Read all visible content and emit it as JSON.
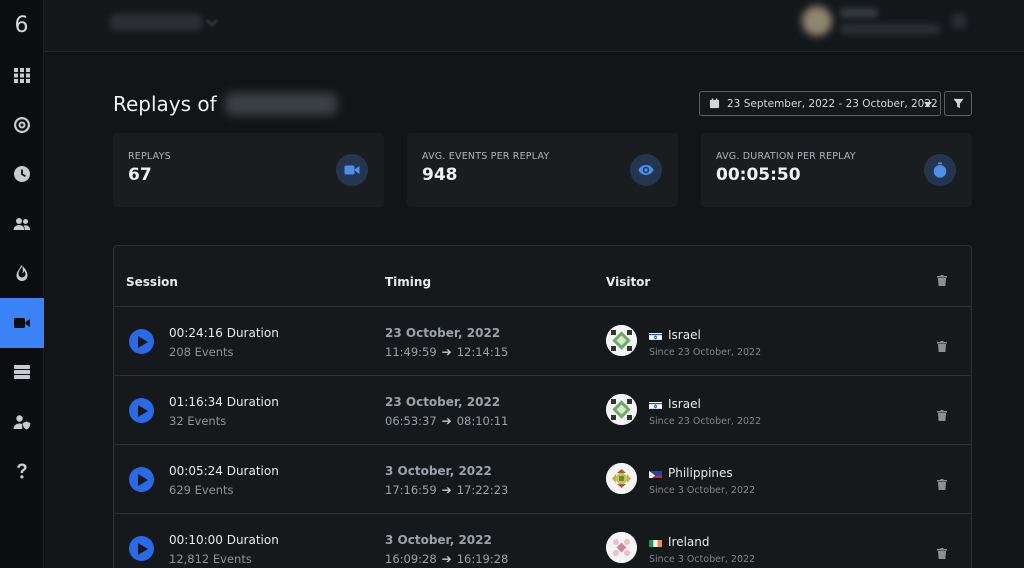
{
  "app": {
    "logo": "6"
  },
  "sidebar": {
    "items": [
      {
        "name": "dashboard",
        "icon": "grid-icon",
        "active": false
      },
      {
        "name": "goals",
        "icon": "target-icon",
        "active": false
      },
      {
        "name": "realtime",
        "icon": "clock-icon",
        "active": false
      },
      {
        "name": "visitors",
        "icon": "users-icon",
        "active": false
      },
      {
        "name": "heatmaps",
        "icon": "fire-icon",
        "active": false
      },
      {
        "name": "replays",
        "icon": "video-icon",
        "active": true
      },
      {
        "name": "data",
        "icon": "server-icon",
        "active": false
      },
      {
        "name": "users",
        "icon": "user-shield-icon",
        "active": false
      },
      {
        "name": "help",
        "icon": "question-icon",
        "active": false
      }
    ]
  },
  "page": {
    "title": "Replays of",
    "date_range": "23 September, 2022 - 23 October, 2022"
  },
  "stats": [
    {
      "label": "REPLAYS",
      "value": "67",
      "icon": "video-icon"
    },
    {
      "label": "AVG. EVENTS PER REPLAY",
      "value": "948",
      "icon": "eye-icon"
    },
    {
      "label": "AVG. DURATION PER REPLAY",
      "value": "00:05:50",
      "icon": "stopwatch-icon"
    }
  ],
  "table": {
    "headers": {
      "session": "Session",
      "timing": "Timing",
      "visitor": "Visitor"
    },
    "rows": [
      {
        "duration": "00:24:16 Duration",
        "events": "208 Events",
        "date": "23 October, 2022",
        "start": "11:49:59",
        "end": "12:14:15",
        "country": "Israel",
        "flag": "israel-flag",
        "since": "Since 23 October, 2022"
      },
      {
        "duration": "01:16:34 Duration",
        "events": "32 Events",
        "date": "23 October, 2022",
        "start": "06:53:37",
        "end": "08:10:11",
        "country": "Israel",
        "flag": "israel-flag",
        "since": "Since 23 October, 2022"
      },
      {
        "duration": "00:05:24 Duration",
        "events": "629 Events",
        "date": "3 October, 2022",
        "start": "17:16:59",
        "end": "17:22:23",
        "country": "Philippines",
        "flag": "philippines-flag",
        "since": "Since 3 October, 2022"
      },
      {
        "duration": "00:10:00 Duration",
        "events": "12,812 Events",
        "date": "3 October, 2022",
        "start": "16:09:28",
        "end": "16:19:28",
        "country": "Ireland",
        "flag": "ireland-flag",
        "since": "Since 3 October, 2022"
      }
    ]
  },
  "colors": {
    "accent": "#3b82f6",
    "play": "#2a6ae9",
    "background": "#121416",
    "card": "#1a1d20"
  }
}
